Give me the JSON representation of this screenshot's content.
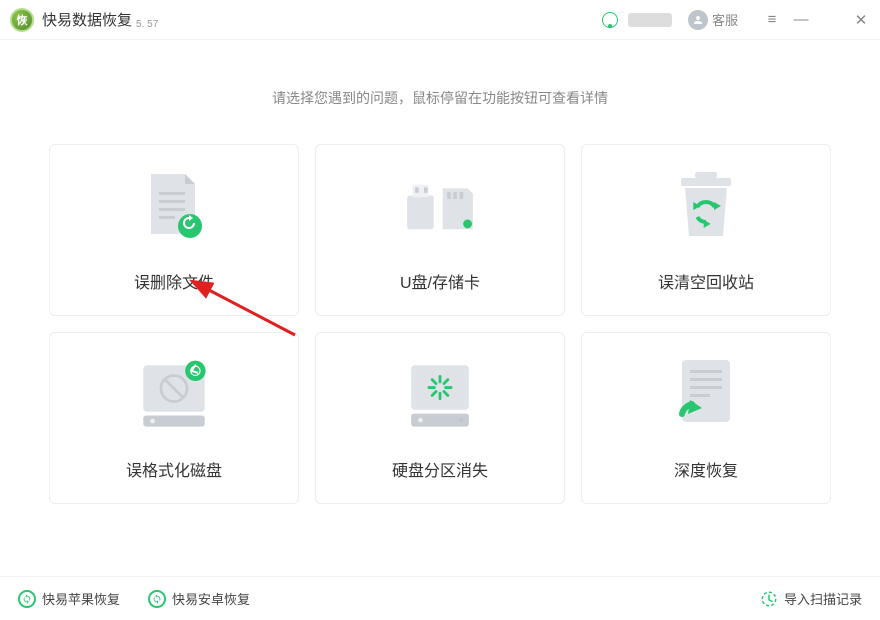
{
  "app": {
    "title": "快易数据恢复",
    "version": "5. 57",
    "logo_text": "恢"
  },
  "titlebar": {
    "customer_service": "客服"
  },
  "subtitle": "请选择您遇到的问题，鼠标停留在功能按钮可查看详情",
  "cards": [
    {
      "label": "误删除文件"
    },
    {
      "label": "U盘/存储卡"
    },
    {
      "label": "误清空回收站"
    },
    {
      "label": "误格式化磁盘"
    },
    {
      "label": "硬盘分区消失"
    },
    {
      "label": "深度恢复"
    }
  ],
  "bottom": {
    "apple": "快易苹果恢复",
    "android": "快易安卓恢复",
    "import": "导入扫描记录"
  }
}
